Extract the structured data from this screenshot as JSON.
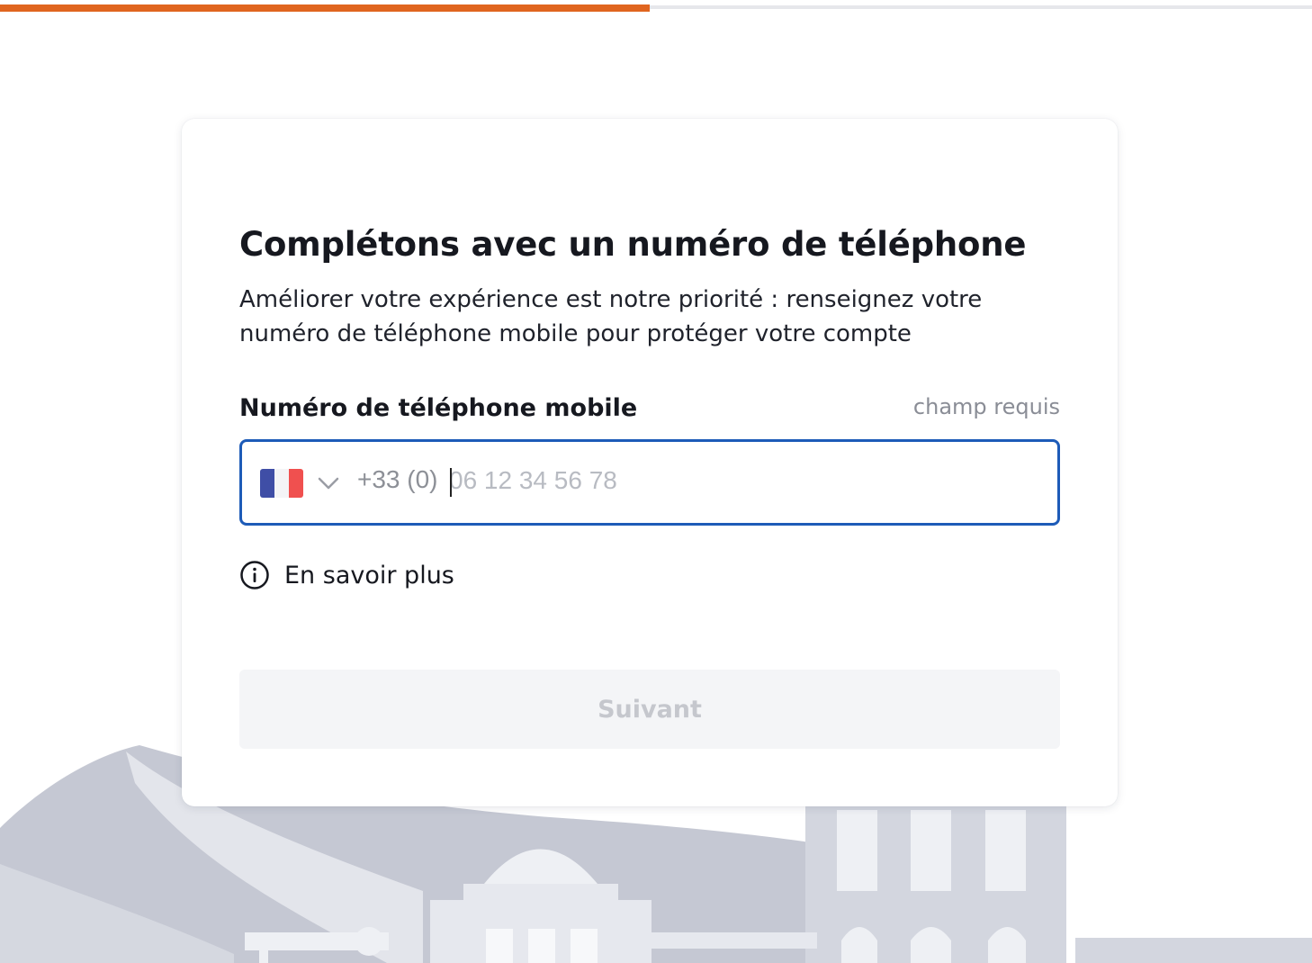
{
  "progress": {
    "fraction": 0.495,
    "fill_color": "#e0651f",
    "track_color": "#e6e7eb"
  },
  "card": {
    "title": "Complétons avec un numéro de téléphone",
    "subtitle": "Améliorer votre expérience est notre priorité : renseignez votre numéro de téléphone mobile pour protéger votre compte"
  },
  "phone_field": {
    "label": "Numéro de téléphone mobile",
    "required_hint": "champ requis",
    "country_flag": "france-flag",
    "dial_code": "+33 (0)",
    "value": "",
    "placeholder": "06 12 34 56 78",
    "border_color": "#1d5bb8"
  },
  "learn_more": {
    "icon": "info-icon",
    "label": "En savoir plus"
  },
  "actions": {
    "next_label": "Suivant",
    "next_disabled": true
  },
  "colors": {
    "accent_blue": "#1d5bb8",
    "brand_orange": "#e0651f",
    "illustration": "#c4c7d2"
  }
}
